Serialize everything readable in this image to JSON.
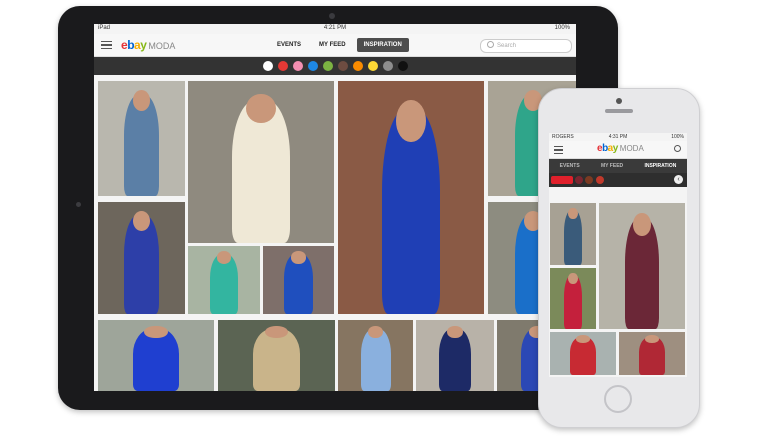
{
  "ipad": {
    "status": {
      "carrier": "iPad",
      "time": "4:21 PM",
      "battery": "100%"
    },
    "logo": {
      "e": "e",
      "b": "b",
      "a": "a",
      "y": "y",
      "moda": "MODA"
    },
    "tabs": [
      {
        "label": "EVENTS",
        "active": false
      },
      {
        "label": "MY FEED",
        "active": false
      },
      {
        "label": "INSPIRATION",
        "active": true
      }
    ],
    "search_placeholder": "Search",
    "color_filters": [
      "#ffffff",
      "#e53935",
      "#f48fb1",
      "#1e88e5",
      "#7cb342",
      "#6d4c41",
      "#fb8c00",
      "#fdd835",
      "#8d8d8d",
      "#111111"
    ]
  },
  "iphone": {
    "status": {
      "carrier": "ROGERS",
      "time": "4:31 PM",
      "battery": "100%"
    },
    "logo": {
      "e": "e",
      "b": "b",
      "a": "a",
      "y": "y",
      "moda": "MODA"
    },
    "tabs": [
      {
        "label": "EVENTS",
        "active": false
      },
      {
        "label": "MY FEED",
        "active": false
      },
      {
        "label": "INSPIRATION",
        "active": true
      }
    ],
    "color_filters": [
      "#e0202b",
      "#7a2630",
      "#7b3a22",
      "#c0392b"
    ],
    "back_glyph": "‹"
  }
}
